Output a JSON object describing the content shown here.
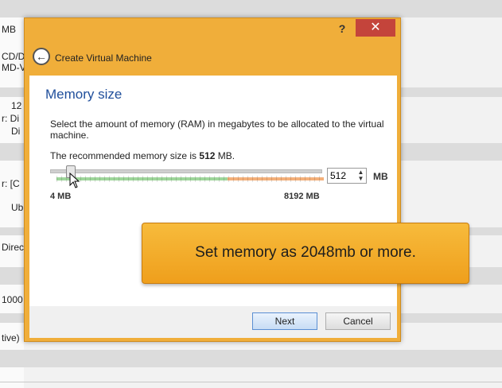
{
  "background": {
    "fragments": [
      "MB",
      "CD/D",
      "MD-V",
      "12",
      "r: Di",
      "Di",
      "r: [C",
      "Ub",
      "Direc",
      "1000",
      "tive)"
    ]
  },
  "dialog": {
    "help_label": "?",
    "close_label": "✕",
    "back_label": "←",
    "title": "Create Virtual Machine",
    "section_title": "Memory size",
    "description": "Select the amount of memory (RAM) in megabytes to be allocated to the virtual machine.",
    "recommend_prefix": "The recommended memory size is ",
    "recommend_value": "512",
    "recommend_suffix": " MB.",
    "slider": {
      "min_label": "4 MB",
      "max_label": "8192 MB",
      "value": 512,
      "min": 4,
      "max": 8192
    },
    "spin_value": "512",
    "unit": "MB",
    "next_label": "Next",
    "cancel_label": "Cancel"
  },
  "callout": {
    "text": "Set memory as 2048mb or more."
  },
  "colors": {
    "accent": "#f0ae3a",
    "title_blue": "#1f4e9b",
    "close_red": "#c4443b"
  }
}
